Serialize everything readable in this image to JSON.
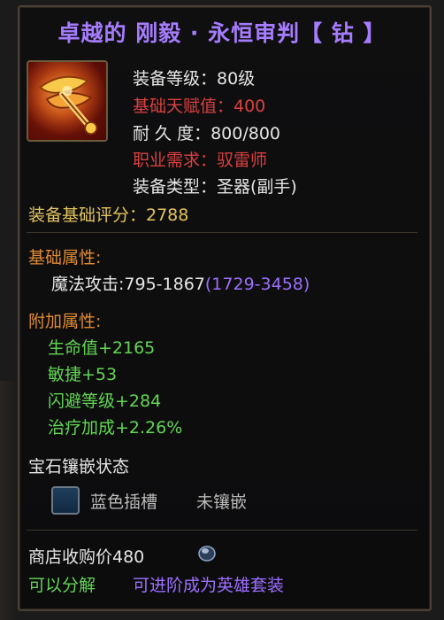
{
  "title": "卓越的 刚毅 · 永恒审判【 钻 】",
  "item_icon": "holy-relic-icon",
  "stats": {
    "equip_level": "装备等级：80级",
    "base_talent": "基础天赋值：400",
    "durability": "耐 久 度：800/800",
    "job_req": "职业需求：驭雷师",
    "equip_type": "装备类型：圣器(副手)",
    "base_score": "装备基础评分：2788"
  },
  "base_attributes": {
    "header": "基础属性:",
    "magic_attack": "魔法攻击:795-1867",
    "magic_attack_bonus": "(1729-3458)"
  },
  "extra_attributes": {
    "header": "附加属性:",
    "items": [
      "生命值+2165",
      "敏捷+53",
      "闪避等级+284",
      "治疗加成+2.26%"
    ]
  },
  "gem": {
    "header": "宝石镶嵌状态",
    "slot_label": "蓝色插槽",
    "slot_status": "未镶嵌"
  },
  "shop": {
    "price": "商店收购价480",
    "decompose": "可以分解",
    "advance": "可进阶成为英雄套装"
  },
  "colors": {
    "title": "#a67cff",
    "white": "#e6e6e6",
    "red": "#d94040",
    "yellow": "#e3c45c",
    "orange": "#e08a32",
    "green": "#62d653",
    "purple": "#9d6fff"
  }
}
